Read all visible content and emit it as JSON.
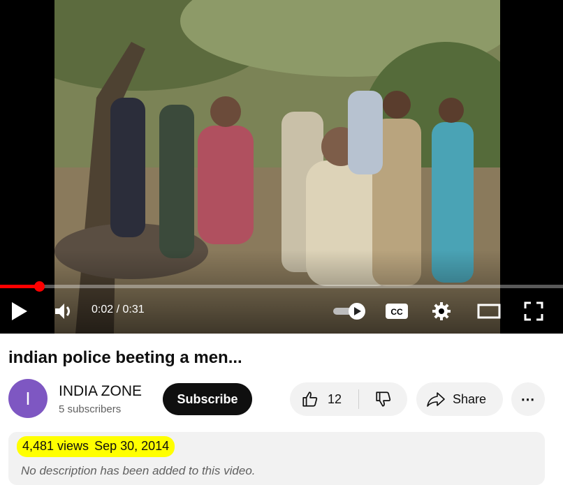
{
  "player": {
    "time_display": "0:02 / 0:31",
    "progress_fraction": 0.07,
    "colors": {
      "progress": "#ff0000"
    }
  },
  "video": {
    "title": "indian police beeting a men..."
  },
  "channel": {
    "avatar_letter": "I",
    "avatar_color": "#7e57c2",
    "name": "INDIA ZONE",
    "subscribers": "5 subscribers",
    "subscribe_label": "Subscribe"
  },
  "actions": {
    "like_count": "12",
    "share_label": "Share",
    "more_label": "⋯",
    "icons": [
      "thumbs-up-icon",
      "thumbs-down-icon",
      "share-arrow-icon",
      "more-icon"
    ]
  },
  "description": {
    "views": "4,481 views",
    "date": "Sep 30, 2014",
    "text": "No description has been added to this video.",
    "highlight_color": "#ffff00"
  }
}
